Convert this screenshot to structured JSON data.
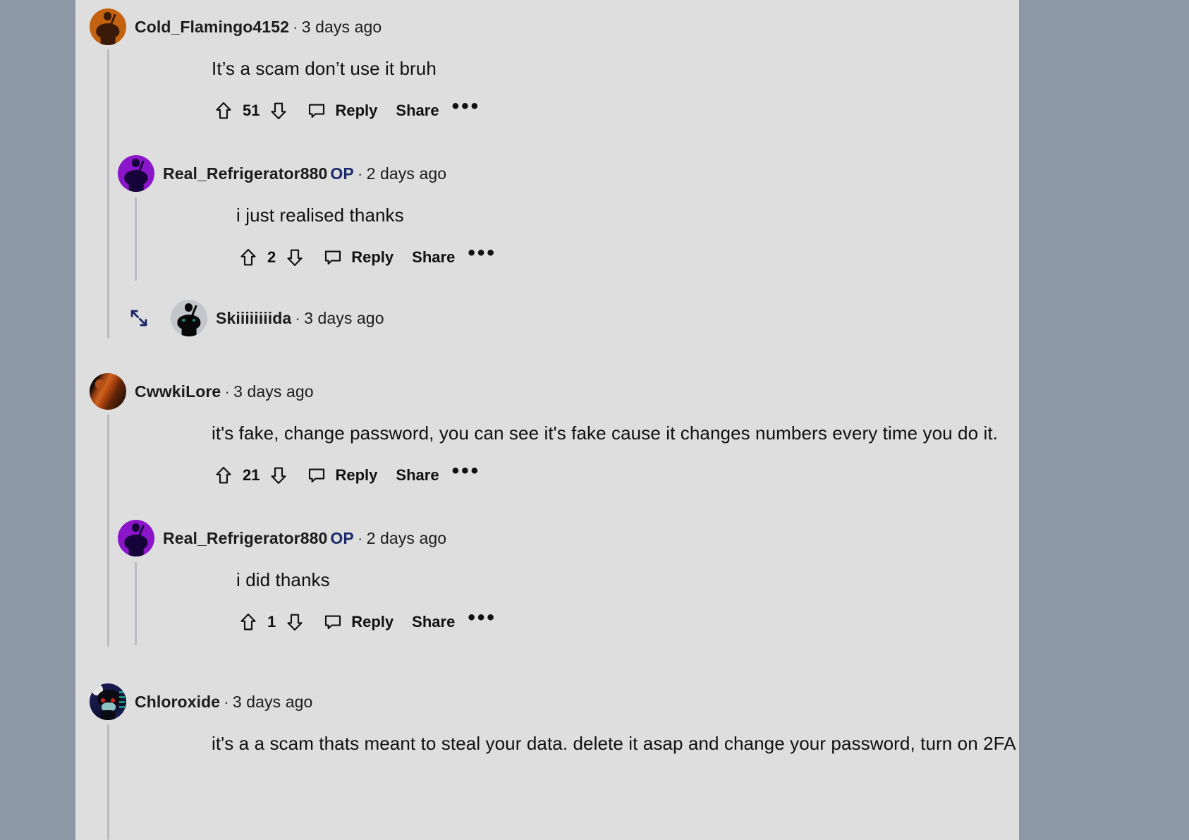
{
  "page": {
    "app": "reddit-comments",
    "background_color": "#8d98a6",
    "content_background": "#dedede",
    "thread_line_color": "#b9bdc1"
  },
  "labels": {
    "reply": "Reply",
    "share": "Share",
    "more": "•••",
    "op_badge": "OP",
    "separator": "·"
  },
  "comments": [
    {
      "id": "c1",
      "username": "Cold_Flamingo4152",
      "is_op": false,
      "timestamp": "3 days ago",
      "body": "It’s a scam don’t use it bruh",
      "votes": "51",
      "avatar": {
        "type": "snoo",
        "bg": "#c4620f",
        "fg": "#3a1a08",
        "eye": "#3a1a08"
      },
      "collapsed": false,
      "replies": [
        {
          "id": "c1r1",
          "username": "Real_Refrigerator880",
          "is_op": true,
          "timestamp": "2 days ago",
          "body": "i just realised thanks",
          "votes": "2",
          "avatar": {
            "type": "snoo",
            "bg": "#8b15c9",
            "fg": "#16033a",
            "eye": "#16033a"
          },
          "collapsed": false
        },
        {
          "id": "c1r2",
          "username": "Skiiiiiiiida",
          "is_op": false,
          "timestamp": "3 days ago",
          "body": "",
          "votes": "",
          "avatar": {
            "type": "snoo",
            "bg": "#c3c7cb",
            "fg": "#080808",
            "eye": "#1f8c78"
          },
          "collapsed": true
        }
      ]
    },
    {
      "id": "c2",
      "username": "CwwkiLore",
      "is_op": false,
      "timestamp": "3 days ago",
      "body": "it's fake, change password, you can see it's fake cause it changes numbers every time you do it.",
      "votes": "21",
      "avatar": {
        "type": "photo-flame",
        "bg": "#1a0d07",
        "fg": "#c7581a",
        "eye": "#000000"
      },
      "collapsed": false,
      "replies": [
        {
          "id": "c2r1",
          "username": "Real_Refrigerator880",
          "is_op": true,
          "timestamp": "2 days ago",
          "body": "i did thanks",
          "votes": "1",
          "avatar": {
            "type": "snoo",
            "bg": "#8b15c9",
            "fg": "#16033a",
            "eye": "#16033a"
          },
          "collapsed": false
        }
      ]
    },
    {
      "id": "c3",
      "username": "Chloroxide",
      "is_op": false,
      "timestamp": "3 days ago",
      "body": "it's a a scam thats meant to steal your data. delete it asap and change your password, turn on 2FA",
      "votes": "",
      "avatar": {
        "type": "hacker-snoo",
        "bg": "#12133a",
        "fg": "#0b0b12",
        "eye": "#cc2222"
      },
      "collapsed": false,
      "replies": []
    }
  ]
}
